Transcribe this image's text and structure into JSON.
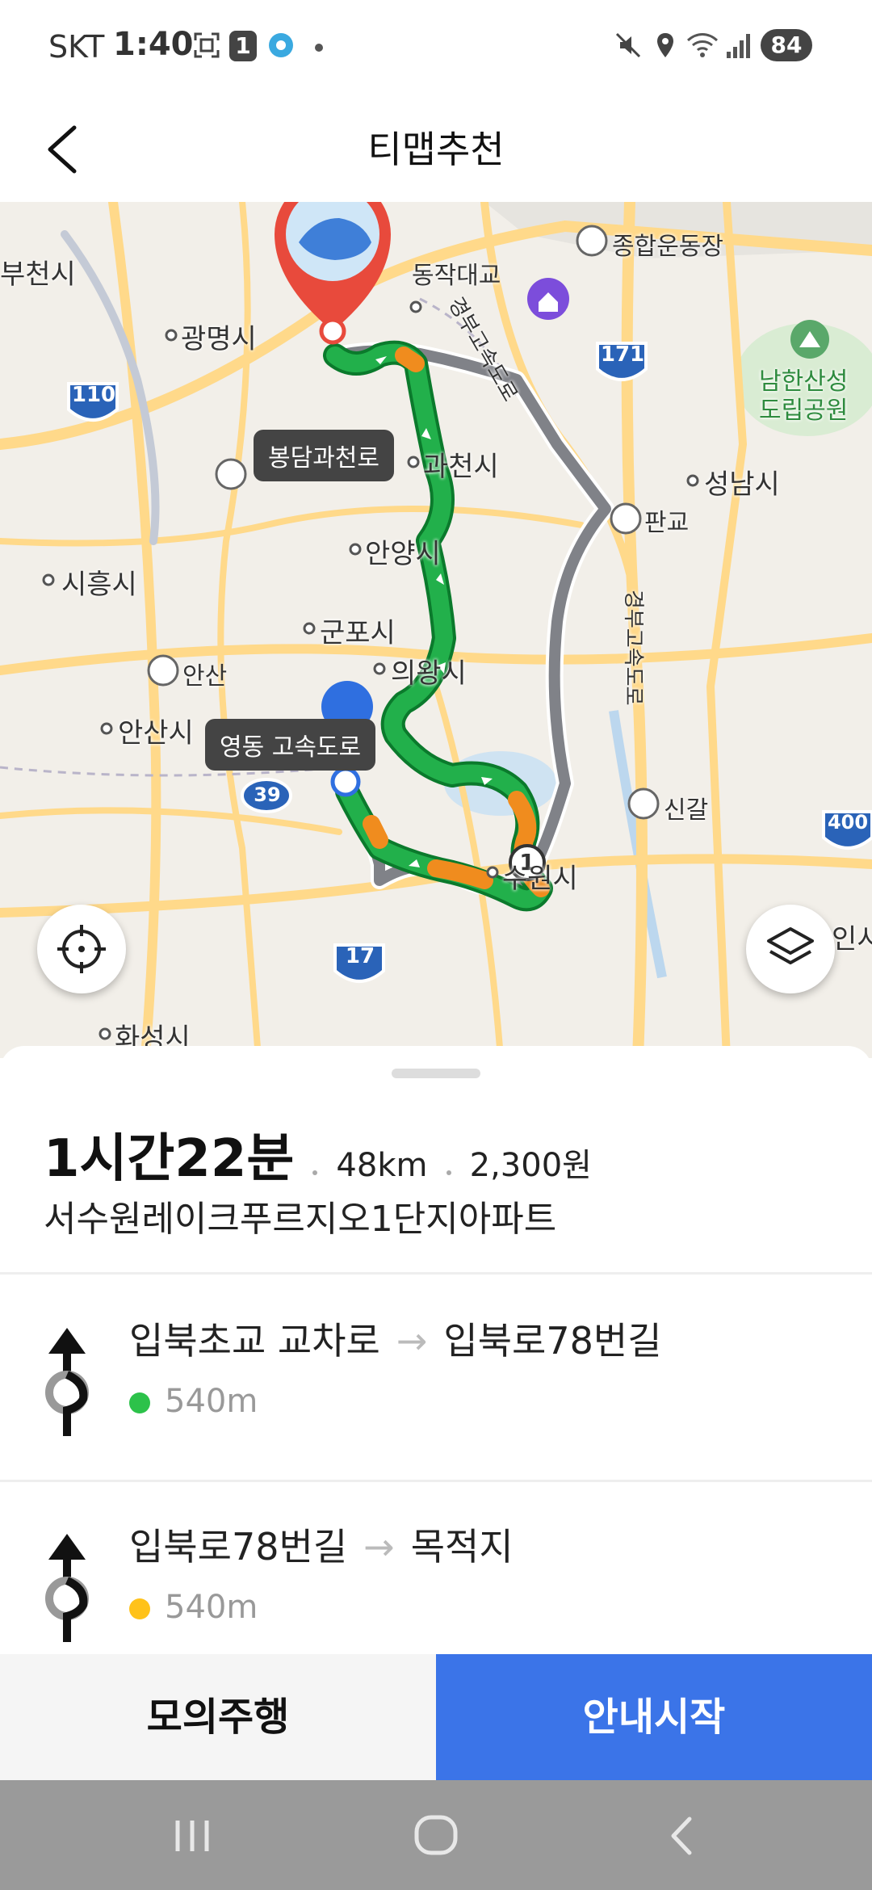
{
  "status_bar": {
    "carrier": "SKT",
    "time": "1:40",
    "notification_badge": "1",
    "battery": "84"
  },
  "header": {
    "title": "티맵추천"
  },
  "map": {
    "labels": {
      "bucheon": "부천시",
      "gwangmyeong": "광명시",
      "dongjak": "동작대교",
      "sports": "종합운동장",
      "namhansanseong": "남한산성\n도립공원",
      "gwacheon": "과천시",
      "seongnam": "성남시",
      "pangyo": "판교",
      "anyang": "안양시",
      "siheung": "시흥시",
      "gunpo": "군포시",
      "uiwang": "의왕시",
      "ansan_jc": "안산",
      "ansan": "안산시",
      "singal": "신갈",
      "suwon": "수원시",
      "hwaseong": "화성시",
      "gyeongbu1": "경부고속도로",
      "gyeongbu2": "경부고속도로",
      "yongin": "인시"
    },
    "road_tags": {
      "bongdam": "봉담과천로",
      "yeongdong": "영동 고속도로"
    },
    "highway_shields": {
      "h110": "110",
      "h171": "171",
      "h39": "39",
      "h17": "17",
      "h400": "400"
    },
    "waypoint_number": "1",
    "colors": {
      "route_main": "#22b04b",
      "route_congested": "#f08c1e",
      "route_alt": "#808288",
      "accent": "#3b74e8"
    }
  },
  "route": {
    "duration": "1시간22분",
    "distance": "48km",
    "toll": "2,300원",
    "destination": "서수원레이크푸르지오1단지아파트",
    "steps": [
      {
        "from": "입북초교 교차로",
        "to": "입북로78번길",
        "distance": "540m",
        "dot_color": "#2cc24a"
      },
      {
        "from": "입북로78번길",
        "to": "목적지",
        "distance": "540m",
        "dot_color": "#ffc21a"
      }
    ]
  },
  "actions": {
    "simulate": "모의주행",
    "start": "안내시작"
  }
}
